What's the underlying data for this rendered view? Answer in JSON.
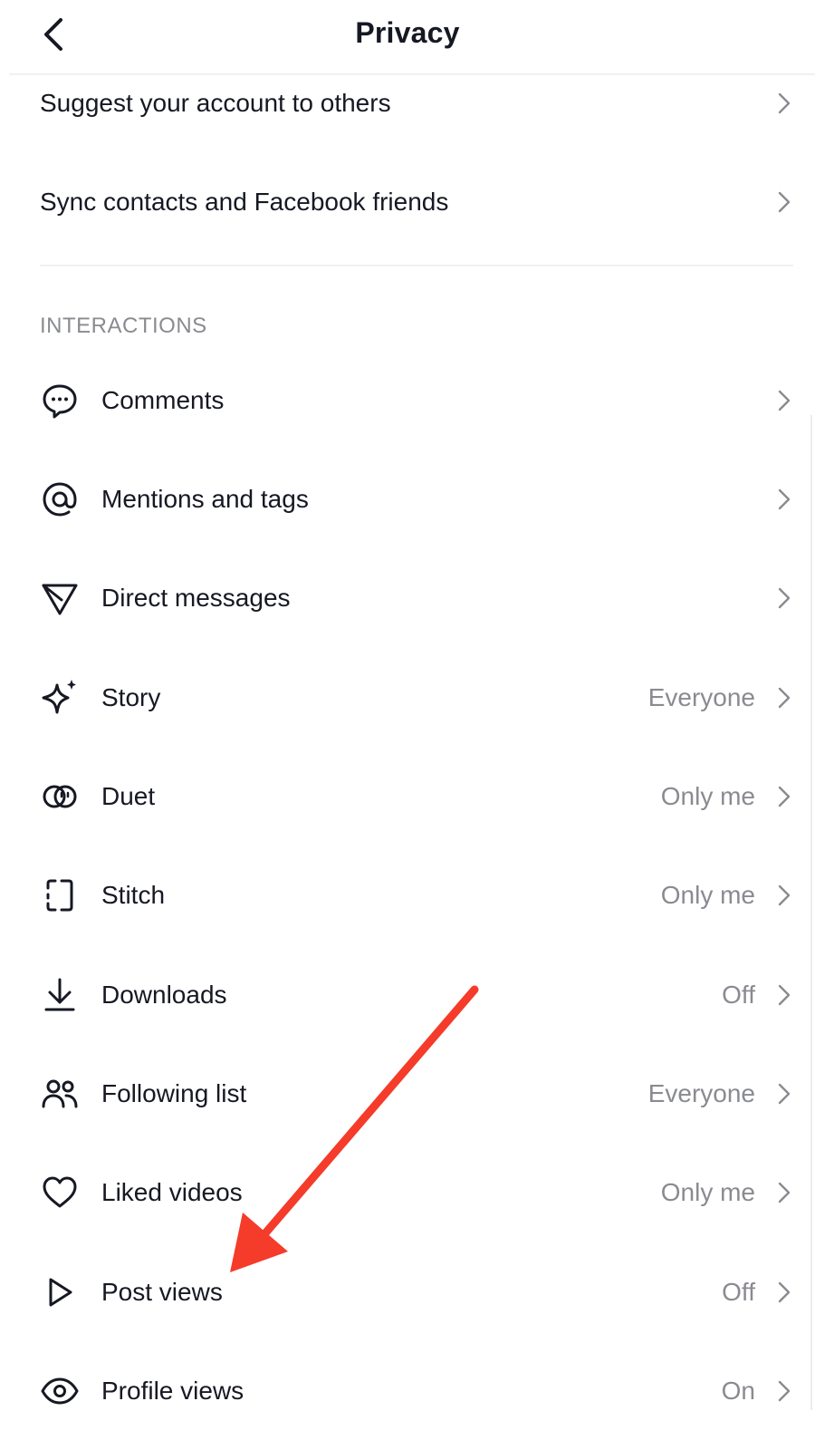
{
  "header": {
    "title": "Privacy",
    "back_icon": "chevron-left-icon"
  },
  "top_items": [
    {
      "label": "Suggest your account to others",
      "value": ""
    },
    {
      "label": "Sync contacts and Facebook friends",
      "value": ""
    }
  ],
  "interactions": {
    "section_title": "INTERACTIONS",
    "items": [
      {
        "label": "Comments",
        "value": "",
        "icon": "comment-bubble-icon"
      },
      {
        "label": "Mentions and tags",
        "value": "",
        "icon": "at-sign-icon"
      },
      {
        "label": "Direct messages",
        "value": "",
        "icon": "send-icon"
      },
      {
        "label": "Story",
        "value": "Everyone",
        "icon": "sparkle-icon"
      },
      {
        "label": "Duet",
        "value": "Only me",
        "icon": "duet-icon"
      },
      {
        "label": "Stitch",
        "value": "Only me",
        "icon": "stitch-icon"
      },
      {
        "label": "Downloads",
        "value": "Off",
        "icon": "download-icon"
      },
      {
        "label": "Following list",
        "value": "Everyone",
        "icon": "users-icon"
      },
      {
        "label": "Liked videos",
        "value": "Only me",
        "icon": "heart-icon"
      },
      {
        "label": "Post views",
        "value": "Off",
        "icon": "play-icon"
      },
      {
        "label": "Profile views",
        "value": "On",
        "icon": "eye-icon"
      }
    ]
  },
  "annotation": {
    "arrow_color": "#f53b2a"
  },
  "colors": {
    "text": "#161823",
    "secondary": "#8a8b91",
    "divider": "#f1f1f2"
  }
}
